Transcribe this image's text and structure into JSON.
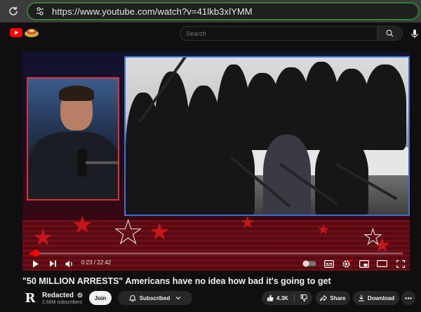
{
  "browser": {
    "url": "https://www.youtube.com/watch?v=41lkb3xlYMM"
  },
  "header": {
    "search_placeholder": "Search"
  },
  "player": {
    "current_time": "0:23",
    "duration": "22:42",
    "time_display": "0:23 / 22:42",
    "progress_fraction": 0.017
  },
  "video": {
    "title": "\"50 MILLION ARRESTS\" Americans have no idea how bad it's going to get"
  },
  "channel": {
    "avatar_letter": "R",
    "name": "Redacted",
    "subscribers": "2.66M subscribers",
    "verified_icon": "verified-check-icon"
  },
  "actions": {
    "join_label": "Join",
    "subscribed_label": "Subscribed",
    "like_count": "4.3K",
    "share_label": "Share",
    "download_label": "Download"
  },
  "colors": {
    "address_border": "#2e7d32",
    "progress": "#ff0000",
    "frame_border": "#3d6fd1",
    "accent_red": "#c4161c"
  }
}
